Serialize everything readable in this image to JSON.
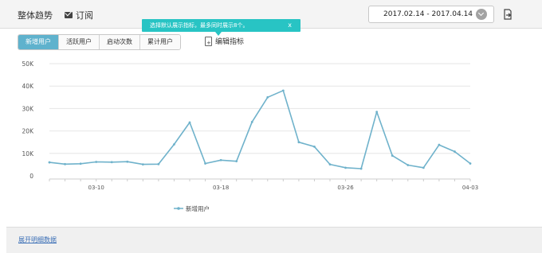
{
  "header": {
    "title": "整体趋势",
    "subscribe_label": "订阅",
    "date_range": "2017.02.14 - 2017.04.14"
  },
  "tooltip": {
    "text": "选择默认展示指标，最多同时展示8个。",
    "close": "x"
  },
  "metric_tabs": [
    "新增用户",
    "活跃用户",
    "启动次数",
    "累计用户"
  ],
  "active_tab": 0,
  "edit_metrics_label": "编辑指标",
  "footer": {
    "link": "展开明细数据"
  },
  "colors": {
    "line": "#6fb2cb",
    "active_tab": "#5fb2cd",
    "tooltip": "#28c4c4"
  },
  "chart_data": {
    "type": "line",
    "title": "",
    "xlabel": "",
    "ylabel": "",
    "ylim": [
      0,
      50000
    ],
    "y_ticks": [
      "50K",
      "40K",
      "30K",
      "20K",
      "10K",
      "0"
    ],
    "x_tick_labels": [
      "03-10",
      "03-18",
      "03-26",
      "04-03"
    ],
    "x_tick_positions": [
      3,
      11,
      19,
      27
    ],
    "grid": true,
    "legend": "bottom",
    "series": [
      {
        "name": "新增用户",
        "values": [
          6000,
          5200,
          5400,
          6200,
          6100,
          6300,
          5100,
          5200,
          14000,
          23800,
          5500,
          7000,
          6500,
          24000,
          35000,
          38000,
          15000,
          13000,
          5100,
          3600,
          3200,
          28500,
          9000,
          4800,
          3600,
          13800,
          10800,
          5500
        ]
      }
    ]
  }
}
